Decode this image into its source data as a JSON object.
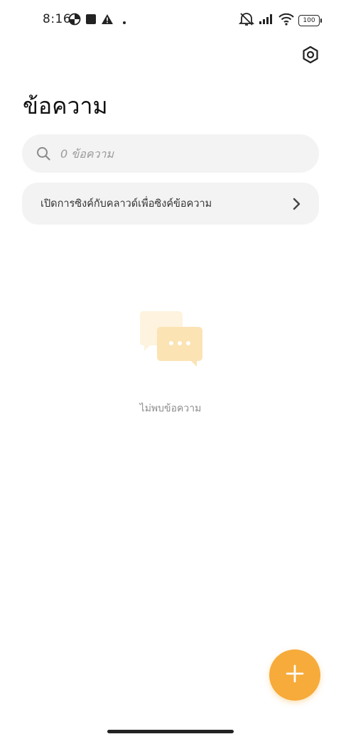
{
  "status_bar": {
    "time": "8:16",
    "battery": "100",
    "icons": [
      "data-saver-icon",
      "square-notification-icon",
      "warning-icon",
      "dot-icon",
      "mute-icon",
      "signal-icon",
      "wifi-icon",
      "battery-icon"
    ]
  },
  "header": {
    "title": "ข้อความ",
    "settings_icon": "gear-icon"
  },
  "search": {
    "placeholder": "0 ข้อความ",
    "icon": "search-icon"
  },
  "sync_banner": {
    "label": "เปิดการซิงค์กับคลาวด์เพื่อซิงค์ข้อความ",
    "icon": "chevron-right-icon"
  },
  "empty_state": {
    "message": "ไม่พบข้อความ",
    "illustration": "chat-bubbles-icon"
  },
  "fab": {
    "icon": "plus-icon",
    "color": "#f6ab3a"
  },
  "colors": {
    "accent": "#f6ab3a",
    "surface": "#f3f3f3",
    "illustration_light": "#fdf3de",
    "illustration_mid": "#fbe3b4"
  }
}
